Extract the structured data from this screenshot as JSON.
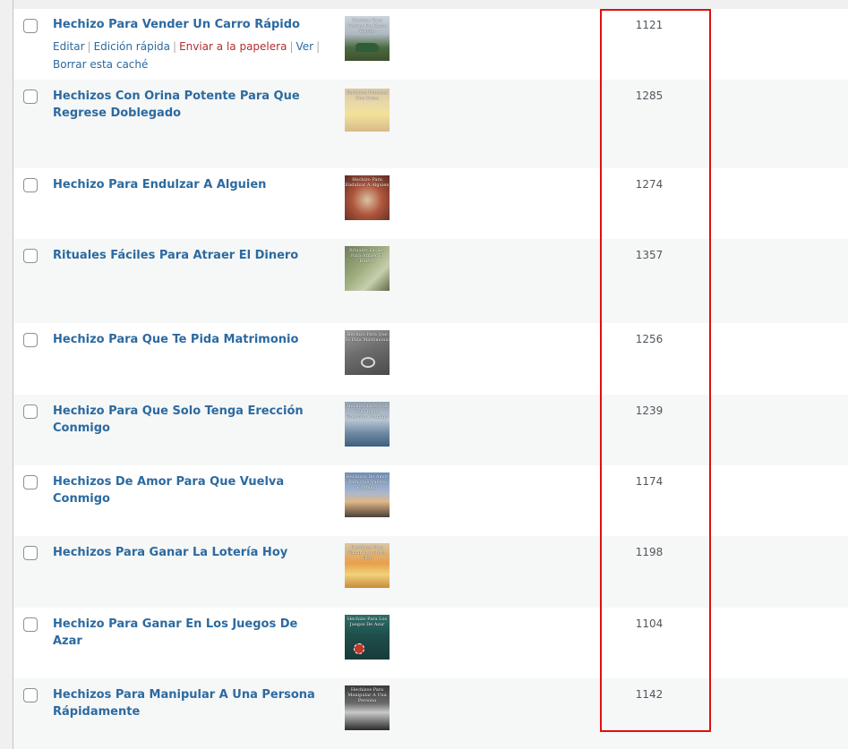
{
  "row_actions": {
    "edit": "Editar",
    "quick_edit": "Edición rápida",
    "trash": "Enviar a la papelera",
    "view": "Ver",
    "clear_cache": "Borrar esta caché",
    "separator": "|"
  },
  "rows": [
    {
      "title": "Hechizo Para Vender Un Carro Rápido",
      "count": "1121",
      "thumb_caption": "Hechizo Para Vender Un Carro Rápido"
    },
    {
      "title": "Hechizos Con Orina Potente Para Que Regrese Doblegado",
      "count": "1285",
      "thumb_caption": "Hechizos Potentes Con Orina"
    },
    {
      "title": "Hechizo Para Endulzar A Alguien",
      "count": "1274",
      "thumb_caption": "Hechizo Para Endulzar A Alguien"
    },
    {
      "title": "Rituales Fáciles Para Atraer El Dinero",
      "count": "1357",
      "thumb_caption": "Rituales Fáciles Para Atraer El Dinero"
    },
    {
      "title": "Hechizo Para Que Te Pida Matrimonio",
      "count": "1256",
      "thumb_caption": "Hechizo Para Que Te Pida Matrimonio"
    },
    {
      "title": "Hechizo Para Que Solo Tenga Erección Conmigo",
      "count": "1239",
      "thumb_caption": "Hechizo Para Que Solo Tenga Erección Conmigo"
    },
    {
      "title": "Hechizos De Amor Para Que Vuelva Conmigo",
      "count": "1174",
      "thumb_caption": "Hechizos De Amor Para Que Vuelva Conmigo"
    },
    {
      "title": "Hechizos Para Ganar La Lotería Hoy",
      "count": "1198",
      "thumb_caption": "Hechizos Para Ganar La Lotería Hoy"
    },
    {
      "title": "Hechizo Para Ganar En Los Juegos De Azar",
      "count": "1104",
      "thumb_caption": "Hechizo Para Los Juegos De Azar"
    },
    {
      "title": "Hechizos Para Manipular A Una Persona Rápidamente",
      "count": "1142",
      "thumb_caption": "Hechizos Para Manipular A Una Persona"
    }
  ],
  "colors": {
    "link": "#2c6aa0",
    "trash": "#b32d2e",
    "highlight": "#e01010"
  }
}
